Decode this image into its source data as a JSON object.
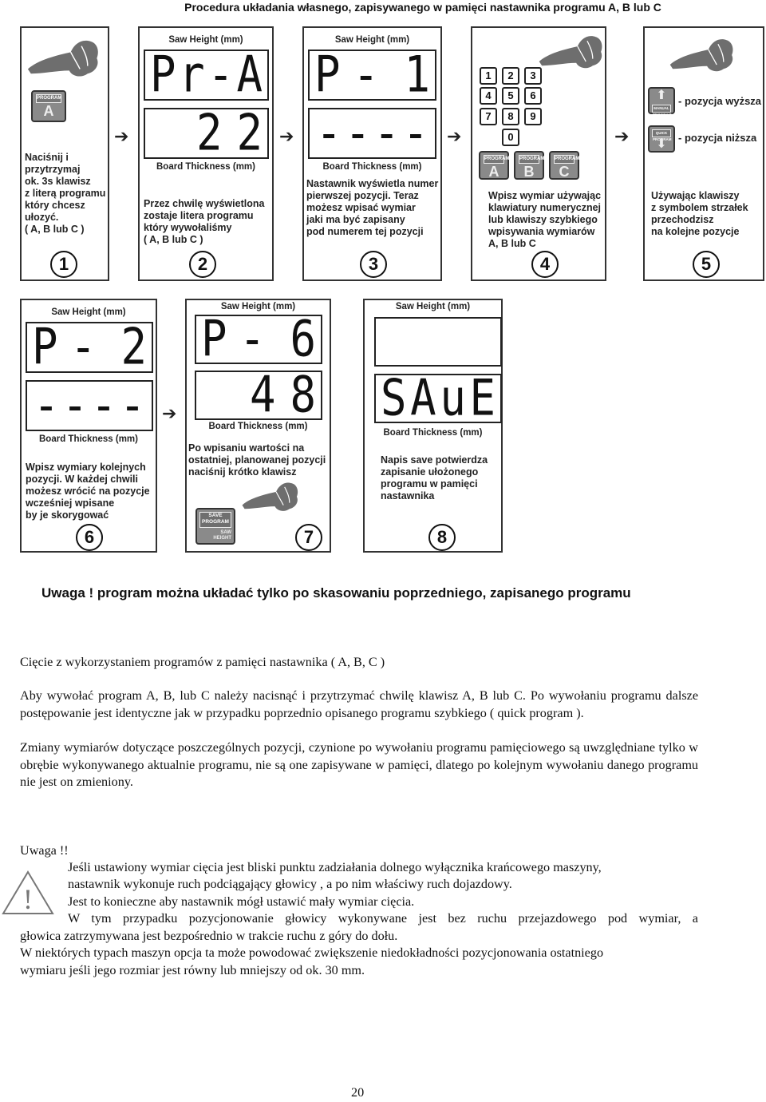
{
  "title": "Procedura układania własnego, zapisywanego w pamięci nastawnika programu A, B lub C",
  "display_labels": {
    "saw_height": "Saw Height (mm)",
    "board_thickness": "Board Thickness (mm)"
  },
  "steps": [
    {
      "number": "1",
      "key": {
        "tag": "PROGRAM",
        "letter": "A"
      },
      "text": "Naciśnij i\nprzytrzymaj\nok. 3s klawisz\nz literą programu\nktóry chcesz\nułozyć.\n ( A, B lub C )"
    },
    {
      "number": "2",
      "top_display": [
        "P",
        "r",
        "-",
        "A"
      ],
      "bottom_display": [
        "2",
        "2"
      ],
      "text": "Przez chwilę wyświetlona\nzostaje litera programu\nktóry wywołaliśmy\n   ( A, B lub C )"
    },
    {
      "number": "3",
      "top_display": [
        "P",
        "-",
        "",
        "1"
      ],
      "bottom_display": [
        "-",
        "-",
        "-",
        "-"
      ],
      "text": "Nastawnik wyświetla numer\npierwszej pozycji. Teraz\nmożesz wpisać wymiar\njaki ma być zapisany\npod numerem tej pozycji"
    },
    {
      "number": "4",
      "keypad": [
        "1",
        "2",
        "3",
        "4",
        "5",
        "6",
        "7",
        "8",
        "9",
        "0"
      ],
      "program_keys": [
        {
          "tag": "PROGRAM",
          "letter": "A"
        },
        {
          "tag": "PROGRAM",
          "letter": "B"
        },
        {
          "tag": "PROGRAM",
          "letter": "C"
        }
      ],
      "text": "Wpisz wymiar używając\nklawiatury numerycznej\nlub klawiszy szybkiego\nwpisywania wymiarów\nA, B lub C"
    },
    {
      "number": "5",
      "up_key": {
        "tag": "MANUAL PROGRAM",
        "label": "- pozycja wyższa"
      },
      "down_key": {
        "tag": "QUICK PROGRAM",
        "label": "- pozycja niższa"
      },
      "text": "Używając klawiszy\nz symbolem strzałek\nprzechodzisz\nna kolejne pozycje"
    },
    {
      "number": "6",
      "top_display": [
        "P",
        "-",
        "",
        "2"
      ],
      "bottom_display": [
        "-",
        "-",
        "-",
        "-"
      ],
      "text": "Wpisz wymiary kolejnych\npozycji. W każdej chwili\nmożesz wrócić na pozycje\nwcześniej wpisane\nby je skorygować"
    },
    {
      "number": "7",
      "top_display": [
        "P",
        "-",
        "",
        "6"
      ],
      "bottom_display": [
        "4",
        "8"
      ],
      "save_key": {
        "tag": "SAVE\nPROGRAM",
        "sub": "SAW\nHEIGHT"
      },
      "text": "Po wpisaniu wartości na\nostatniej, planowanej pozycji\nnaciśnij krótko klawisz"
    },
    {
      "number": "8",
      "top_display": [],
      "bottom_display": [
        "S",
        "A",
        "u",
        "E"
      ],
      "text": "Napis save potwierdza\nzapisanie ułożonego\nprogramu w pamięci\nnastawnika"
    }
  ],
  "warning_banner": "Uwaga !  program można układać tylko po skasowaniu poprzedniego, zapisanego programu",
  "section": {
    "heading": "Cięcie z wykorzystaniem programów z pamięci nastawnika ( A, B, C )",
    "p1": "Aby wywołać program A,  B, lub C należy nacisnąć i przytrzymać chwilę klawisz A, B lub C. Po wywołaniu programu dalsze postępowanie jest identyczne jak w przypadku poprzednio opisanego programu szybkiego ( quick program ).",
    "p2": "Zmiany wymiarów dotyczące poszczególnych pozycji, czynione po wywołaniu programu pamięciowego są uwzględniane tylko w obrębie wykonywanego aktualnie programu, nie są one zapisywane w pamięci, dlatego po kolejnym wywołaniu danego programu nie jest on zmieniony."
  },
  "caution": {
    "heading": "Uwaga !!",
    "icon": "warning-triangle-icon",
    "lines": [
      "Jeśli ustawiony wymiar cięcia jest bliski punktu zadziałania dolnego wyłącznika krańcowego maszyny,",
      "nastawnik wykonuje ruch podciągający głowicy , a po nim właściwy ruch dojazdowy.",
      "Jest to konieczne aby nastawnik mógł ustawić mały wymiar  cięcia.",
      "W tym przypadku pozycjonowanie głowicy wykonywane jest bez ruchu przejazdowego pod wymiar, a",
      "głowica zatrzymywana jest bezpośrednio w trakcie ruchu z góry do dołu.",
      "W niektórych typach maszyn opcja ta może powodować zwiększenie niedokładności pozycjonowania ostatniego",
      "wymiaru jeśli jego rozmiar jest równy lub mniejszy od ok. 30 mm."
    ]
  },
  "page_number": "20"
}
